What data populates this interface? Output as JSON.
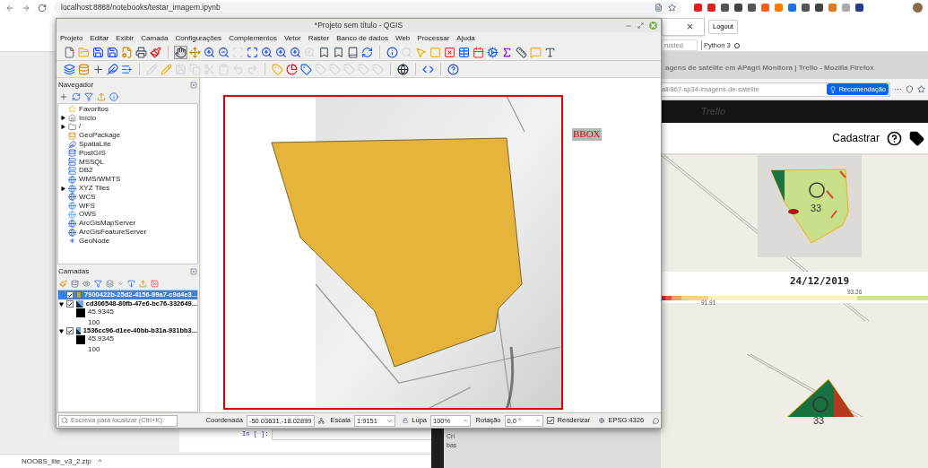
{
  "browser": {
    "address": "localhost:8888/notebooks/testar_imagem.ipynb"
  },
  "notebook": {
    "popup_close": "×",
    "logout": "Logout",
    "trusted": "rusted",
    "kernel": "Python 3",
    "cell_prompt": "In [ ]:",
    "fragments": [
      "Cri",
      "bas"
    ]
  },
  "downloads": {
    "file": "NOOBS_lite_v3_2.zip",
    "caret": "^"
  },
  "firefox": {
    "title": "agens de satélite em APagri Monitora | Trello - Mozilla Firefox",
    "url": "ali/867-sp34-imagens-de-satélite",
    "recommend": "Recomendação",
    "more": "···",
    "logo": "Trello",
    "header_link": "Cadastrar",
    "date": "24/12/2019",
    "scale_labels": [
      "93.26",
      "91.91"
    ],
    "field_labels": [
      "33",
      "33"
    ]
  },
  "qgis": {
    "title": "*Projeto sem título - QGIS",
    "menus": [
      "Projeto",
      "Editar",
      "Exibir",
      "Camada",
      "Configurações",
      "Complementos",
      "Vetor",
      "Raster",
      "Banco de dados",
      "Web",
      "Processar",
      "Ajuda"
    ],
    "navigator": {
      "title": "Navegador",
      "items": [
        {
          "label": "Favoritos",
          "expandable": false
        },
        {
          "label": "Início",
          "expandable": true
        },
        {
          "label": "/",
          "expandable": true
        },
        {
          "label": "GeoPackage",
          "expandable": false
        },
        {
          "label": "SpatiaLite",
          "expandable": false
        },
        {
          "label": "PostGIS",
          "expandable": false
        },
        {
          "label": "MSSQL",
          "expandable": false
        },
        {
          "label": "DB2",
          "expandable": false
        },
        {
          "label": "WMS/WMTS",
          "expandable": false
        },
        {
          "label": "XYZ Tiles",
          "expandable": true
        },
        {
          "label": "WCS",
          "expandable": false
        },
        {
          "label": "WFS",
          "expandable": false
        },
        {
          "label": "OWS",
          "expandable": false
        },
        {
          "label": "ArcGisMapServer",
          "expandable": false
        },
        {
          "label": "ArcGisFeatureServer",
          "expandable": false
        },
        {
          "label": "GeoNode",
          "expandable": false
        }
      ]
    },
    "layers": {
      "title": "Camadas",
      "items": [
        {
          "name": "7900422b-25d2-4156-99a7-c9d4e3...",
          "kind": "vector",
          "checked": true,
          "selected": true
        },
        {
          "name": "cd306548-80fb-47e6-bc76-332649...",
          "kind": "raster",
          "checked": true,
          "selected": false,
          "expanded": true,
          "legend": [
            "45.9345",
            "100"
          ]
        },
        {
          "name": "1536cc96-d1ee-40bb-b31a-931bb3...",
          "kind": "raster",
          "checked": true,
          "selected": false,
          "expanded": true,
          "legend": [
            "45.9345",
            "100"
          ]
        }
      ]
    },
    "map": {
      "label": "BBOX"
    },
    "status": {
      "search_placeholder": "Escreva para localizar (Ctrl+K)",
      "coordinate_label": "Coordenada",
      "coordinate": "-50.03631,-18.02899",
      "scale_label": "Escala",
      "scale": "1:9151",
      "magnifier_label": "Lupa",
      "magnifier": "100%",
      "rotation_label": "Rotação",
      "rotation": "0,0 °",
      "render_label": "Renderizar",
      "render_checked": true,
      "crs": "EPSG:4326"
    }
  }
}
